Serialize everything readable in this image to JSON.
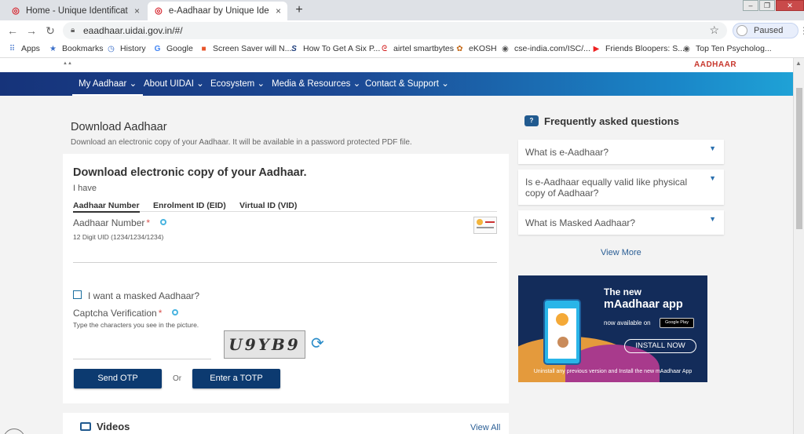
{
  "browser": {
    "tabs": [
      {
        "title": "Home - Unique Identification Au",
        "close": "×"
      },
      {
        "title": "e-Aadhaar by Unique Identificatio",
        "close": "×"
      }
    ],
    "new_tab": "+",
    "url": "eaadhaar.uidai.gov.in/#/",
    "profile_label": "Paused",
    "window_controls": {
      "minimize": "–",
      "restore": "❐",
      "close": "✕"
    }
  },
  "bookmarks": [
    {
      "label": "Apps",
      "icon": "apps-grid-icon"
    },
    {
      "label": "Bookmarks",
      "icon": "star-icon"
    },
    {
      "label": "History",
      "icon": "history-icon"
    },
    {
      "label": "Google",
      "icon": "google-icon"
    },
    {
      "label": "Screen Saver will N...",
      "icon": "windows-icon"
    },
    {
      "label": "How To Get A Six P...",
      "icon": "s-icon"
    },
    {
      "label": "airtel smartbytes",
      "icon": "airtel-icon"
    },
    {
      "label": "eKOSH",
      "icon": "ekosh-icon"
    },
    {
      "label": "cse-india.com/ISC/...",
      "icon": "globe-icon"
    },
    {
      "label": "Friends Bloopers: S...",
      "icon": "youtube-icon"
    },
    {
      "label": "Top Ten Psycholog...",
      "icon": "globe-icon"
    }
  ],
  "site": {
    "brand_word": "AADHAAR",
    "nav": [
      "My Aadhaar",
      "About UIDAI",
      "Ecosystem",
      "Media & Resources",
      "Contact & Support"
    ],
    "nav_chevron": "⌄"
  },
  "download": {
    "title": "Download Aadhaar",
    "subtitle": "Download an electronic copy of your Aadhaar. It will be available in a password protected PDF file.",
    "heading": "Download electronic copy of your Aadhaar.",
    "i_have": "I have",
    "tabs": [
      "Aadhaar Number",
      "Enrolment ID (EID)",
      "Virtual ID (VID)"
    ],
    "aadhaar_label": "Aadhaar Number",
    "required_mark": "*",
    "aadhaar_hint": "12 Digit UID (1234/1234/1234)",
    "masked_label": "I want a masked Aadhaar?",
    "captcha_label": "Captcha Verification",
    "captcha_hint": "Type the characters you see in the picture.",
    "captcha_text": "U9YB9",
    "send_otp": "Send OTP",
    "or": "Or",
    "enter_totp": "Enter a TOTP"
  },
  "faq": {
    "title": "Frequently asked questions",
    "items": [
      "What is e-Aadhaar?",
      "Is e-Aadhaar equally valid like physical copy of Aadhaar?",
      "What is Masked Aadhaar?"
    ],
    "view_more": "View More"
  },
  "promo": {
    "line1": "The new",
    "line2": "mAadhaar app",
    "line3": "now available on",
    "store": "Google Play",
    "install": "INSTALL NOW",
    "footer": "Uninstall any previous version and Install the new mAadhaar App"
  },
  "videos": {
    "title": "Videos",
    "view_all": "View All"
  }
}
